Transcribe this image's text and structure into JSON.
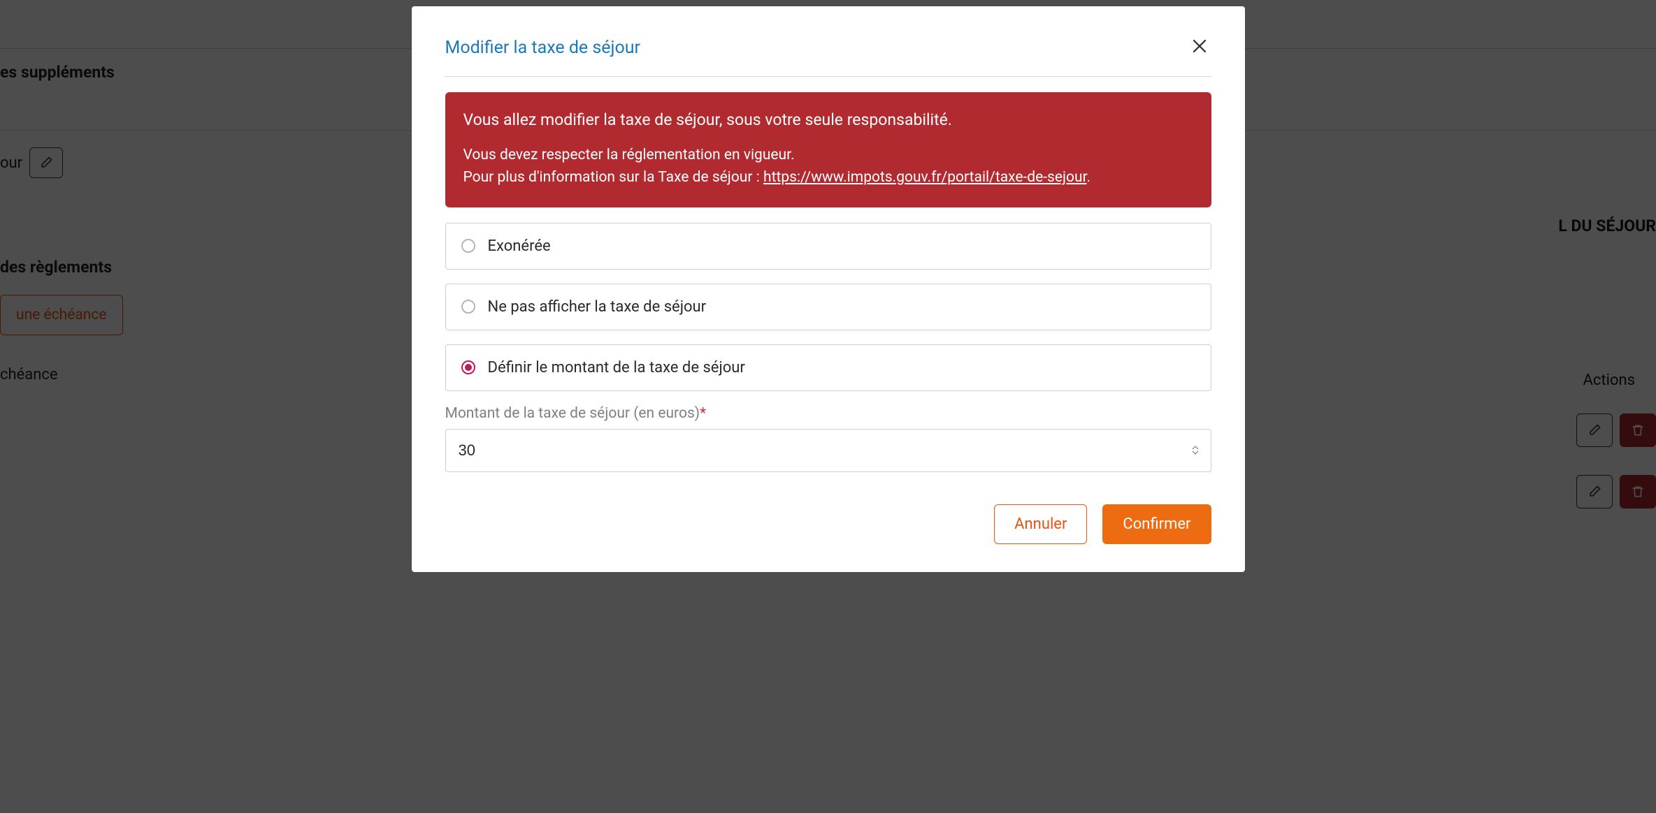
{
  "background": {
    "supplements_title": "es suppléments",
    "sejour_label": "our",
    "reglements_title": "des règlements",
    "add_echeance_btn": "une échéance",
    "echeance_label": "chéance",
    "right_panel_title": "L DU SÉJOUR",
    "actions_header": "Actions"
  },
  "modal": {
    "title": "Modifier la taxe de séjour",
    "alert": {
      "line1": "Vous allez modifier la taxe de séjour, sous votre seule responsabilité.",
      "line2": "Vous devez respecter la réglementation en vigueur.",
      "line3_prefix": "Pour plus d'information sur la Taxe de séjour : ",
      "link_text": "https://www.impots.gouv.fr/portail/taxe-de-sejour",
      "line3_suffix": "."
    },
    "options": {
      "exempt": "Exonérée",
      "hide": "Ne pas afficher la taxe de séjour",
      "define": "Définir le montant de la taxe de séjour"
    },
    "amount_label": "Montant de la taxe de séjour (en euros)",
    "amount_value": "30",
    "buttons": {
      "cancel": "Annuler",
      "confirm": "Confirmer"
    }
  }
}
